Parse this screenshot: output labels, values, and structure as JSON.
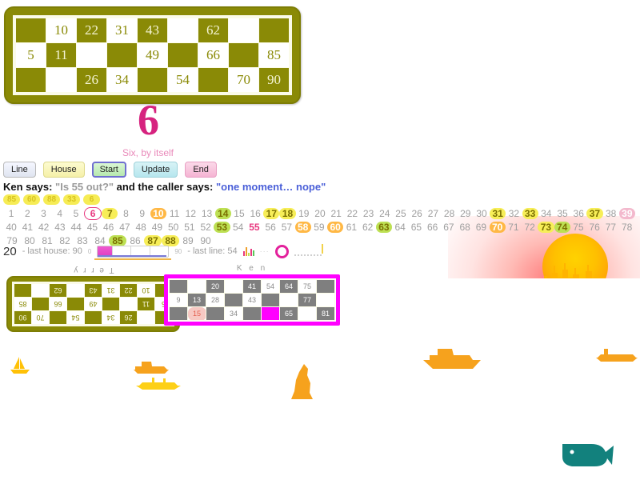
{
  "host_card": {
    "name": "caller-card",
    "rows": [
      [
        {
          "v": "",
          "s": "blank"
        },
        {
          "v": "10",
          "s": "open"
        },
        {
          "v": "22",
          "s": "hit"
        },
        {
          "v": "31",
          "s": "open"
        },
        {
          "v": "43",
          "s": "hit"
        },
        {
          "v": "",
          "s": "open"
        },
        {
          "v": "62",
          "s": "hit"
        },
        {
          "v": "",
          "s": "open"
        },
        {
          "v": "",
          "s": "blank"
        }
      ],
      [
        {
          "v": "5",
          "s": "open"
        },
        {
          "v": "11",
          "s": "hit"
        },
        {
          "v": "",
          "s": "open"
        },
        {
          "v": "",
          "s": "blank"
        },
        {
          "v": "49",
          "s": "open"
        },
        {
          "v": "",
          "s": "blank"
        },
        {
          "v": "66",
          "s": "open"
        },
        {
          "v": "",
          "s": "blank"
        },
        {
          "v": "85",
          "s": "open"
        }
      ],
      [
        {
          "v": "",
          "s": "blank"
        },
        {
          "v": "",
          "s": "open"
        },
        {
          "v": "26",
          "s": "hit"
        },
        {
          "v": "34",
          "s": "open"
        },
        {
          "v": "",
          "s": "blank"
        },
        {
          "v": "54",
          "s": "open"
        },
        {
          "v": "",
          "s": "blank"
        },
        {
          "v": "70",
          "s": "open"
        },
        {
          "v": "90",
          "s": "hit"
        }
      ]
    ]
  },
  "call": {
    "number": "6",
    "nickname": "Six, by itself"
  },
  "buttons": [
    {
      "label": "Line",
      "cls": "b-line",
      "name": "line-button"
    },
    {
      "label": "House",
      "cls": "b-house",
      "name": "house-button"
    },
    {
      "label": "Start",
      "cls": "b-start",
      "name": "start-button"
    },
    {
      "label": "Update",
      "cls": "b-update",
      "name": "update-button"
    },
    {
      "label": "End",
      "cls": "b-end",
      "name": "end-button"
    }
  ],
  "chat": {
    "speaker": "Ken says: ",
    "question": "\"Is 55 out?\"",
    "connector": " and the caller says: ",
    "answer": "\"one moment… nope\""
  },
  "recent_calls": [
    "85",
    "60",
    "88",
    "33",
    "6"
  ],
  "board": {
    "rows": [
      [
        {
          "n": "1"
        },
        {
          "n": "2"
        },
        {
          "n": "3"
        },
        {
          "n": "4"
        },
        {
          "n": "5"
        },
        {
          "n": "6",
          "s": "r"
        },
        {
          "n": "7",
          "s": "y"
        },
        {
          "n": "8"
        },
        {
          "n": "9"
        },
        {
          "n": "10",
          "s": "o"
        },
        {
          "n": "11"
        },
        {
          "n": "12"
        },
        {
          "n": "13"
        },
        {
          "n": "14",
          "s": "g"
        },
        {
          "n": "15"
        },
        {
          "n": "16"
        },
        {
          "n": "17",
          "s": "y"
        },
        {
          "n": "18",
          "s": "y"
        },
        {
          "n": "19"
        },
        {
          "n": "20"
        },
        {
          "n": "21"
        },
        {
          "n": "22"
        },
        {
          "n": "23"
        },
        {
          "n": "24"
        },
        {
          "n": "25"
        },
        {
          "n": "26"
        },
        {
          "n": "27"
        },
        {
          "n": "28"
        },
        {
          "n": "29"
        },
        {
          "n": "30"
        },
        {
          "n": "31",
          "s": "y"
        },
        {
          "n": "32"
        },
        {
          "n": "33",
          "s": "y"
        },
        {
          "n": "34"
        },
        {
          "n": "35"
        },
        {
          "n": "36"
        },
        {
          "n": "37",
          "s": "y"
        },
        {
          "n": "38"
        },
        {
          "n": "39",
          "s": "p"
        }
      ],
      [
        {
          "n": "40"
        },
        {
          "n": "41"
        },
        {
          "n": "42"
        },
        {
          "n": "43"
        },
        {
          "n": "44"
        },
        {
          "n": "45"
        },
        {
          "n": "46"
        },
        {
          "n": "47"
        },
        {
          "n": "48"
        },
        {
          "n": "49"
        },
        {
          "n": "50"
        },
        {
          "n": "51"
        },
        {
          "n": "52"
        },
        {
          "n": "53",
          "s": "g"
        },
        {
          "n": "54"
        },
        {
          "n": "55",
          "s": "t"
        },
        {
          "n": "56"
        },
        {
          "n": "57"
        },
        {
          "n": "58",
          "s": "o"
        },
        {
          "n": "59"
        },
        {
          "n": "60",
          "s": "o"
        },
        {
          "n": "61"
        },
        {
          "n": "62"
        },
        {
          "n": "63",
          "s": "g"
        },
        {
          "n": "64"
        },
        {
          "n": "65"
        },
        {
          "n": "66"
        },
        {
          "n": "67"
        },
        {
          "n": "68"
        },
        {
          "n": "69"
        },
        {
          "n": "70",
          "s": "o"
        },
        {
          "n": "71"
        },
        {
          "n": "72"
        },
        {
          "n": "73",
          "s": "y"
        },
        {
          "n": "74",
          "s": "g"
        },
        {
          "n": "75"
        },
        {
          "n": "76"
        },
        {
          "n": "77"
        },
        {
          "n": "78"
        }
      ],
      [
        {
          "n": "79"
        },
        {
          "n": "80"
        },
        {
          "n": "81"
        },
        {
          "n": "82"
        },
        {
          "n": "83"
        },
        {
          "n": "84"
        },
        {
          "n": "85",
          "s": "g"
        },
        {
          "n": "86"
        },
        {
          "n": "87",
          "s": "y"
        },
        {
          "n": "88",
          "s": "y"
        },
        {
          "n": "89"
        },
        {
          "n": "90"
        }
      ]
    ]
  },
  "status": {
    "count": "20",
    "last_house_label": "- last house: 90",
    "slider_min": "0",
    "slider_max": "90",
    "last_line_label": "- last line: 54",
    "icons": [
      "bar-chart-icon",
      "dots-icon",
      "ring-icon",
      "meter-icon"
    ]
  },
  "terry_card": {
    "label": "T e r r y",
    "rows": [
      [
        {
          "v": "",
          "s": "blank"
        },
        {
          "v": "",
          "s": "open"
        },
        {
          "v": "26",
          "s": "hit"
        },
        {
          "v": "34",
          "s": "open"
        },
        {
          "v": "",
          "s": "blank"
        },
        {
          "v": "54",
          "s": "open"
        },
        {
          "v": "",
          "s": "blank"
        },
        {
          "v": "70",
          "s": "open"
        },
        {
          "v": "90",
          "s": "hit"
        }
      ],
      [
        {
          "v": "5",
          "s": "open"
        },
        {
          "v": "11",
          "s": "hit"
        },
        {
          "v": "",
          "s": "open"
        },
        {
          "v": "",
          "s": "blank"
        },
        {
          "v": "49",
          "s": "open"
        },
        {
          "v": "",
          "s": "blank"
        },
        {
          "v": "66",
          "s": "open"
        },
        {
          "v": "",
          "s": "blank"
        },
        {
          "v": "85",
          "s": "open"
        }
      ],
      [
        {
          "v": "",
          "s": "blank"
        },
        {
          "v": "10",
          "s": "open"
        },
        {
          "v": "22",
          "s": "hit"
        },
        {
          "v": "31",
          "s": "open"
        },
        {
          "v": "43",
          "s": "hit"
        },
        {
          "v": "",
          "s": "open"
        },
        {
          "v": "62",
          "s": "hit"
        },
        {
          "v": "",
          "s": "open"
        },
        {
          "v": "",
          "s": "blank"
        }
      ]
    ]
  },
  "ken_card": {
    "label": "K e n",
    "rows": [
      [
        {
          "v": "",
          "s": "blank"
        },
        {
          "v": "",
          "s": "open"
        },
        {
          "v": "20",
          "s": "hit"
        },
        {
          "v": "",
          "s": "open"
        },
        {
          "v": "41",
          "s": "hit"
        },
        {
          "v": "54",
          "s": "open"
        },
        {
          "v": "64",
          "s": "hit"
        },
        {
          "v": "75",
          "s": "open"
        },
        {
          "v": "",
          "s": "blank"
        }
      ],
      [
        {
          "v": "9",
          "s": "open"
        },
        {
          "v": "13",
          "s": "hit"
        },
        {
          "v": "28",
          "s": "open"
        },
        {
          "v": "",
          "s": "blank"
        },
        {
          "v": "43",
          "s": "open"
        },
        {
          "v": "",
          "s": "blank"
        },
        {
          "v": "",
          "s": "open"
        },
        {
          "v": "77",
          "s": "hit"
        },
        {
          "v": "",
          "s": "open"
        }
      ],
      [
        {
          "v": "",
          "s": "blank"
        },
        {
          "v": "15",
          "s": "mark"
        },
        {
          "v": "",
          "s": "blank"
        },
        {
          "v": "34",
          "s": "open"
        },
        {
          "v": "",
          "s": "blank"
        },
        {
          "v": "",
          "s": "cur"
        },
        {
          "v": "65",
          "s": "hit"
        },
        {
          "v": "",
          "s": "open"
        },
        {
          "v": "81",
          "s": "hit"
        }
      ]
    ]
  },
  "scenery": {
    "sun": "sun-icon",
    "boats": [
      "sailboat-icon",
      "tugboat-icon",
      "ferry-icon",
      "rock-icon",
      "cargo-ship-icon"
    ],
    "whale": "whale-icon"
  },
  "colors": {
    "olive": "#8a8a06",
    "magenta": "#ff00ff",
    "call_pink": "#d6237f",
    "sun_orange": "#ffae00",
    "boat_yellow": "#ffc107"
  }
}
